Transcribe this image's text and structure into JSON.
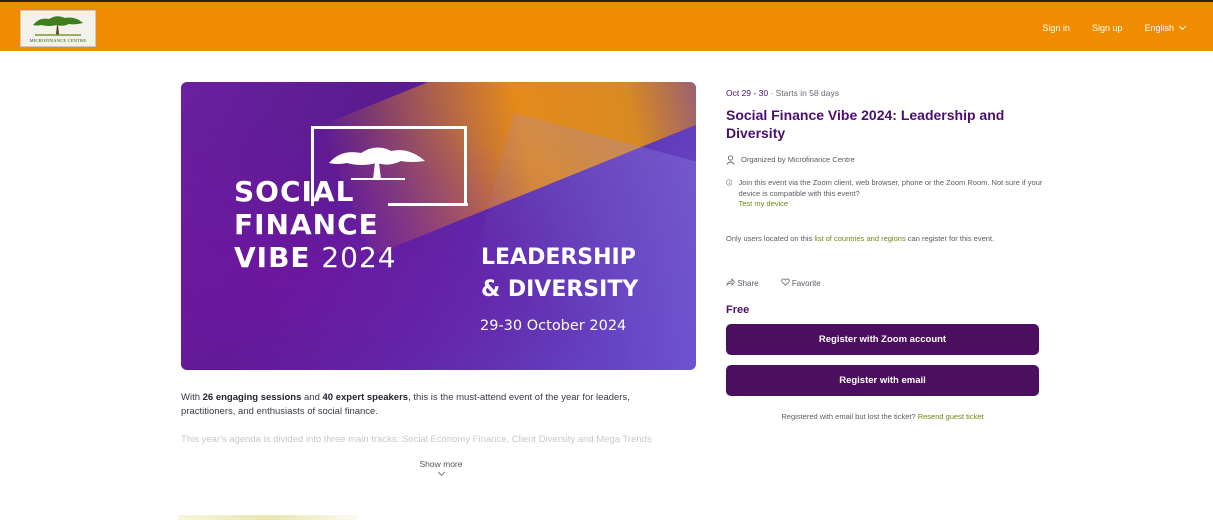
{
  "header": {
    "logo_text": "MICROFINANCE CENTRE",
    "sign_in": "Sign in",
    "sign_up": "Sign up",
    "language": "English"
  },
  "banner": {
    "title_line1": "SOCIAL",
    "title_line2": "FINANCE",
    "title_line3_bold": "VIBE",
    "title_year": "2024",
    "subtitle_line1": "LEADERSHIP",
    "subtitle_line2": "& DIVERSITY",
    "date": "29-30 October 2024"
  },
  "description": {
    "part1": "With ",
    "sessions": "26 engaging sessions",
    "part2": " and ",
    "speakers": "40 expert speakers",
    "part3": ", this is the must-attend event of the year for leaders, practitioners, and enthusiasts of social finance.",
    "faded": "This year's agenda is divided into three main tracks: Social Economy Finance, Client Diversity and Mega Trends",
    "show_more": "Show more"
  },
  "event": {
    "dates": "Oct 29 - 30",
    "separator": "·",
    "starts_in": "Starts in 58 days",
    "title": "Social Finance Vibe 2024: Leadership and Diversity",
    "organizer": "Organized by Microfinance Centre",
    "join_info": "Join this event via the Zoom client, web browser, phone or the Zoom Room. Not sure if your device is compatible with this event?",
    "test_device": "Test my device",
    "only_users_prefix": "Only users located on this ",
    "only_users_link": "list of countries and regions",
    "only_users_suffix": " can register for this event.",
    "share": "Share",
    "favorite": "Favorite",
    "price": "Free",
    "register_zoom": "Register with Zoom account",
    "register_email": "Register with email",
    "lost_prefix": "Registered with email but lost the ticket? ",
    "resend": "Resend guest ticket"
  },
  "colors": {
    "header_orange": "#f08c00",
    "brand_purple": "#4c0e5e",
    "link_green": "#6a8a10"
  }
}
